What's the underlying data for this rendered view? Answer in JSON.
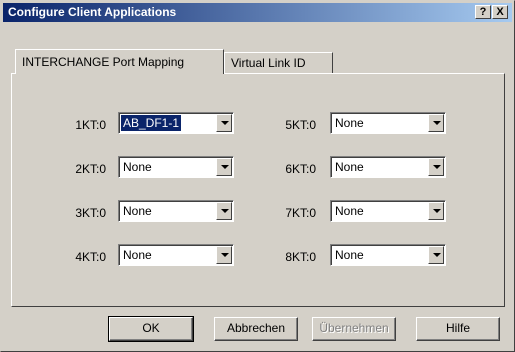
{
  "window": {
    "title": "Configure Client Applications",
    "help_glyph": "?",
    "close_glyph": "X"
  },
  "tabs": [
    {
      "label": "INTERCHANGE Port Mapping",
      "active": true
    },
    {
      "label": "Virtual Link ID",
      "active": false
    }
  ],
  "ports": [
    {
      "label": "1KT:0",
      "value": "AB_DF1-1",
      "selected": true
    },
    {
      "label": "2KT:0",
      "value": "None"
    },
    {
      "label": "3KT:0",
      "value": "None"
    },
    {
      "label": "4KT:0",
      "value": "None"
    },
    {
      "label": "5KT:0",
      "value": "None"
    },
    {
      "label": "6KT:0",
      "value": "None"
    },
    {
      "label": "7KT:0",
      "value": "None"
    },
    {
      "label": "8KT:0",
      "value": "None"
    }
  ],
  "buttons": {
    "ok": "OK",
    "cancel": "Abbrechen",
    "apply": "Übernehmen",
    "help": "Hilfe"
  },
  "colors": {
    "title_start": "#0a246a",
    "title_end": "#a6caf0",
    "face": "#d4d0c8"
  }
}
